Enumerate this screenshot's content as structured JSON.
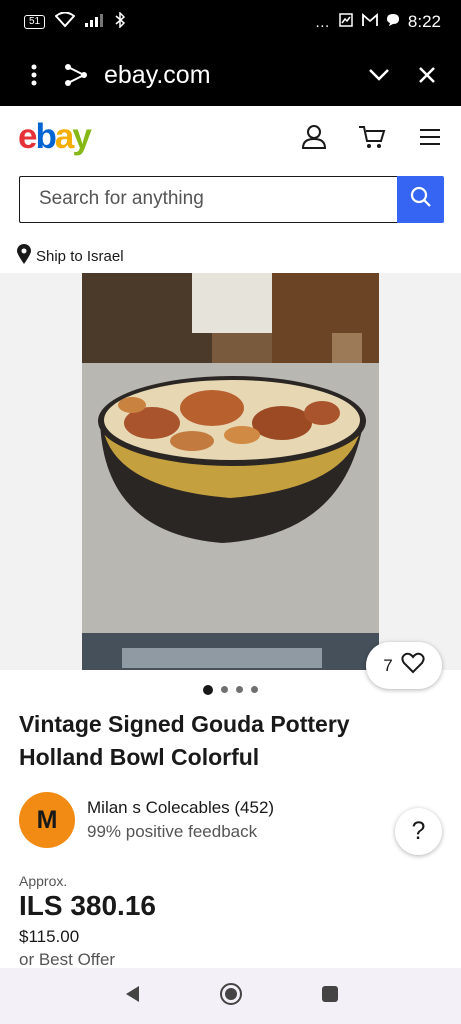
{
  "status_bar": {
    "battery": "51",
    "time": "8:22",
    "overflow": "…"
  },
  "browser": {
    "url": "ebay.com"
  },
  "header": {
    "logo_letters": [
      "e",
      "b",
      "a",
      "y"
    ],
    "colors": {
      "e": "#e53238",
      "b": "#0064d2",
      "a": "#f5af02",
      "y": "#86b817"
    }
  },
  "search": {
    "placeholder": "Search for anything"
  },
  "ship": {
    "label": "Ship to Israel"
  },
  "gallery": {
    "watch_count": "7",
    "total_images": 4,
    "active_index": 0
  },
  "listing": {
    "title": "Vintage Signed Gouda Pottery Holland Bowl Colorful",
    "seller_initial": "M",
    "seller_name": "Milan s Colecables (452)",
    "seller_feedback": "99% positive feedback",
    "approx_label": "Approx.",
    "price": "ILS 380.16",
    "usd_price": "$115.00",
    "best_offer": "or Best Offer"
  },
  "help": {
    "label": "?"
  },
  "accent": "#3665f3"
}
